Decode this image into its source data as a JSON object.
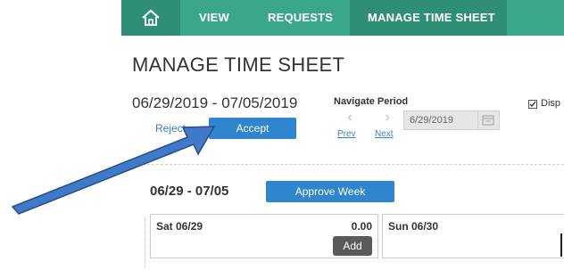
{
  "nav": {
    "home_icon": "home-icon",
    "items": [
      "VIEW",
      "REQUESTS",
      "MANAGE TIME SHEET"
    ]
  },
  "page_title": "MANAGE TIME SHEET",
  "period": {
    "range": "06/29/2019 - 07/05/2019",
    "navigate_label": "Navigate Period",
    "prev": "Prev",
    "next": "Next",
    "date_value": "6/29/2019",
    "display_label": "Disp"
  },
  "actions": {
    "reject": "Reject",
    "accept": "Accept"
  },
  "week": {
    "label": "06/29 - 07/05",
    "approve": "Approve Week"
  },
  "days": [
    {
      "name": "Sat 06/29",
      "hours": "0.00",
      "add": "Add"
    },
    {
      "name": "Sun 06/30"
    }
  ],
  "colors": {
    "nav": "#3aa68b",
    "nav_active": "#2f8f76",
    "primary": "#2f86cf",
    "arrow": "#3f79c9"
  }
}
